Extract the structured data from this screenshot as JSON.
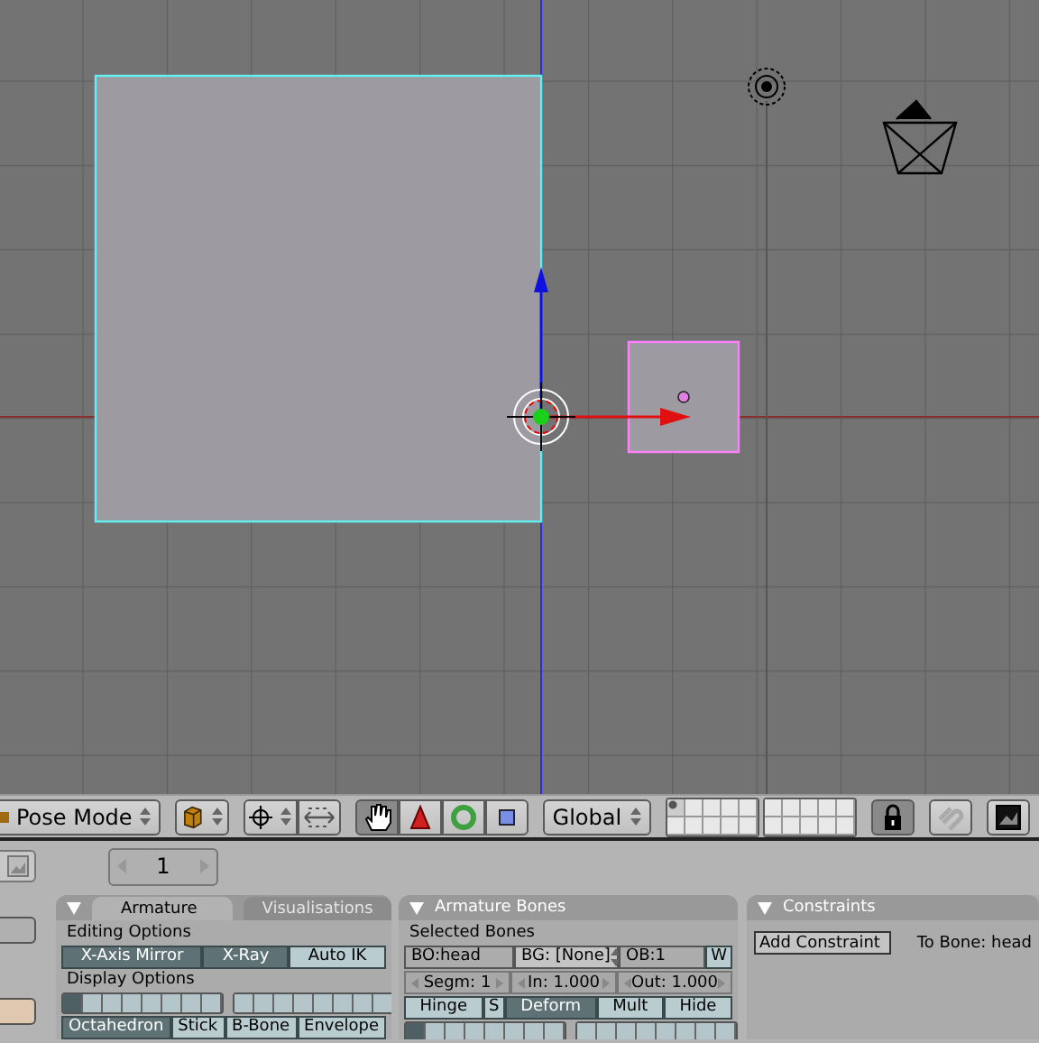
{
  "header": {
    "mode_menu": "Pose Mode",
    "transform_tools": [
      {
        "kind": "hand",
        "selected": true
      },
      {
        "kind": "translate",
        "selected": false
      },
      {
        "kind": "rotate",
        "selected": false
      },
      {
        "kind": "scale",
        "selected": false
      }
    ],
    "orientation_menu": "Global",
    "scene_layers": [
      {
        "selected": true
      },
      {
        "selected": false
      },
      {
        "selected": false
      },
      {
        "selected": false
      },
      {
        "selected": false
      },
      {
        "selected": false
      },
      {
        "selected": false
      },
      {
        "selected": false
      },
      {
        "selected": false
      },
      {
        "selected": false
      },
      {
        "selected": false
      },
      {
        "selected": false
      },
      {
        "selected": false
      },
      {
        "selected": false
      },
      {
        "selected": false
      },
      {
        "selected": false
      },
      {
        "selected": false
      },
      {
        "selected": false
      },
      {
        "selected": false
      },
      {
        "selected": false
      }
    ],
    "lock": {
      "on": true
    }
  },
  "frame_field": "1",
  "armature_panel": {
    "tabs": [
      {
        "label": "Armature",
        "selected": true
      },
      {
        "label": "Visualisations",
        "selected": false
      }
    ],
    "editing_label": "Editing Options",
    "editing_buttons": [
      {
        "label": "X-Axis Mirror",
        "selected": true
      },
      {
        "label": "X-Ray",
        "selected": true
      },
      {
        "label": "Auto IK",
        "selected": false
      }
    ],
    "display_label": "Display Options",
    "layers": [
      {
        "selected": true
      },
      {
        "selected": false
      },
      {
        "selected": false
      },
      {
        "selected": false
      },
      {
        "selected": false
      },
      {
        "selected": false
      },
      {
        "selected": false
      },
      {
        "selected": false
      },
      {
        "selected": false
      },
      {
        "selected": false
      },
      {
        "selected": false
      },
      {
        "selected": false
      },
      {
        "selected": false
      },
      {
        "selected": false
      },
      {
        "selected": false
      },
      {
        "selected": false
      }
    ],
    "draw_types": [
      {
        "label": "Octahedron",
        "selected": true
      },
      {
        "label": "Stick",
        "selected": false
      },
      {
        "label": "B-Bone",
        "selected": false
      },
      {
        "label": "Envelope",
        "selected": false
      }
    ]
  },
  "bones_panel": {
    "title": "Armature Bones",
    "subtitle": "Selected Bones",
    "name_field": "BO:head",
    "group_menu": "BG: [None]",
    "object_field": "OB:1",
    "w_button": {
      "label": "W",
      "selected": false
    },
    "number_fields": [
      "Segm: 1",
      "In: 1.000",
      "Out: 1.000"
    ],
    "options": [
      {
        "label": "Hinge",
        "selected": false
      },
      {
        "label": "S",
        "selected": false
      },
      {
        "label": "Deform",
        "selected": true
      },
      {
        "label": "Mult",
        "selected": false
      },
      {
        "label": "Hide",
        "selected": false
      }
    ],
    "layers": [
      {
        "selected": true
      },
      {
        "selected": false
      },
      {
        "selected": false
      },
      {
        "selected": false
      },
      {
        "selected": false
      },
      {
        "selected": false
      },
      {
        "selected": false
      },
      {
        "selected": false
      },
      {
        "selected": false
      },
      {
        "selected": false
      },
      {
        "selected": false
      },
      {
        "selected": false
      },
      {
        "selected": false
      },
      {
        "selected": false
      },
      {
        "selected": false
      },
      {
        "selected": false
      }
    ]
  },
  "constraints_panel": {
    "title": "Constraints",
    "add_button": "Add Constraint",
    "target_label": "To Bone: head"
  }
}
